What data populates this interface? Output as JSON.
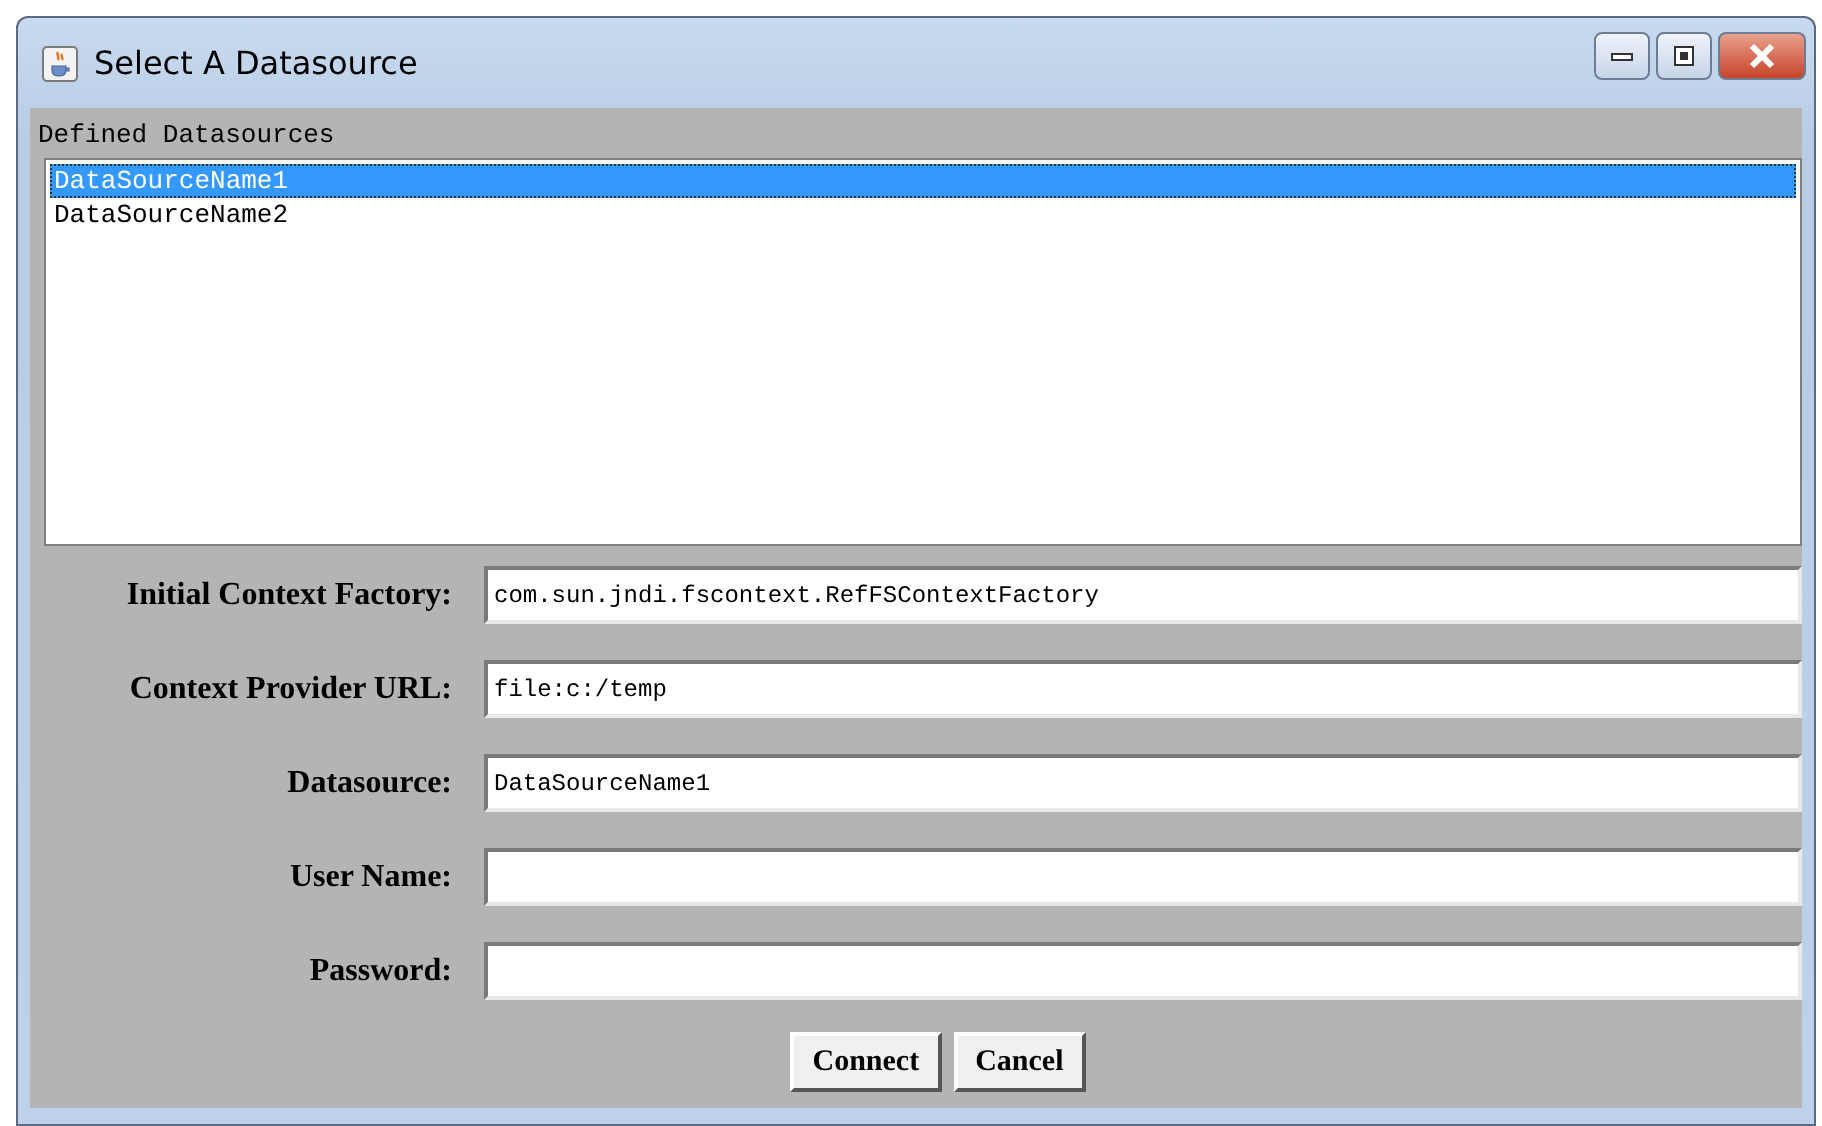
{
  "window": {
    "title": "Select A Datasource"
  },
  "list": {
    "label": "Defined Datasources",
    "items": [
      {
        "name": "DataSourceName1",
        "selected": true
      },
      {
        "name": "DataSourceName2",
        "selected": false
      }
    ]
  },
  "fields": [
    {
      "label": "Initial Context Factory:",
      "value": "com.sun.jndi.fscontext.RefFSContextFactory"
    },
    {
      "label": "Context Provider URL:",
      "value": "file:c:/temp"
    },
    {
      "label": "Datasource:",
      "value": "DataSourceName1"
    },
    {
      "label": "User Name:"
    },
    {
      "label": "Password:"
    }
  ],
  "buttons": [
    "Connect",
    "Cancel"
  ]
}
